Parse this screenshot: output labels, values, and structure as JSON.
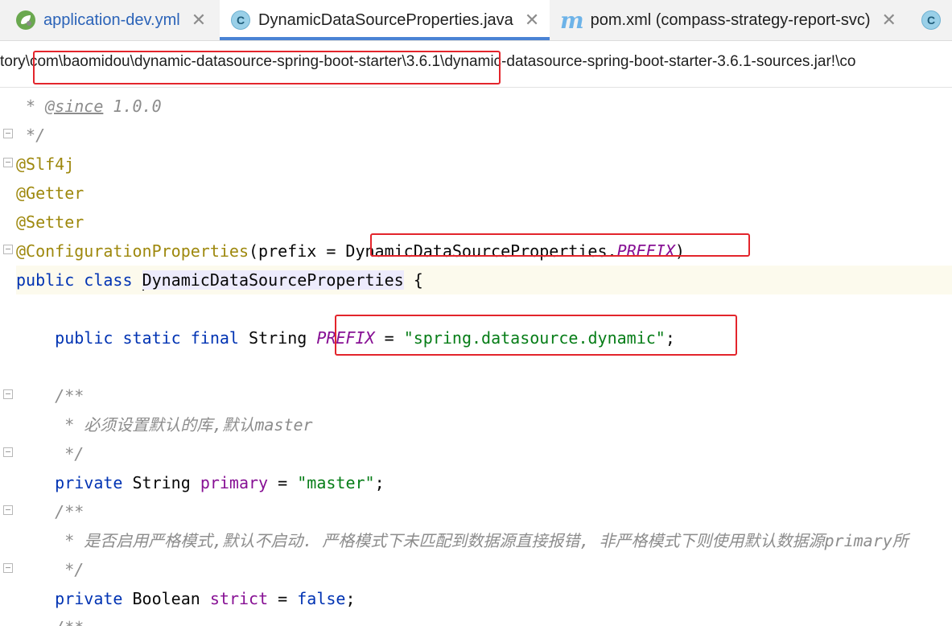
{
  "tabs": [
    {
      "label": "application-dev.yml",
      "icon": "spring-yml-icon",
      "active": false
    },
    {
      "label": "DynamicDataSourceProperties.java",
      "icon": "class-c-icon",
      "active": true
    },
    {
      "label": "pom.xml (compass-strategy-report-svc)",
      "icon": "maven-m-icon",
      "active": false
    },
    {
      "label": "",
      "icon": "class-c-icon",
      "active": false
    }
  ],
  "close_glyph": "✕",
  "breadcrumb": {
    "prefix": "tory\\",
    "highlighted": "com\\baomidou\\dynamic-datasource-spring-boot-starter\\3.6.1\\",
    "rest": "dynamic-datasource-spring-boot-starter-3.6.1-sources.jar!\\co"
  },
  "code": {
    "since_prefix": " * ",
    "since_tag": "@since",
    "since_version": " 1.0.0",
    "comment_end": " */",
    "ann_slf4j": "@Slf4j",
    "ann_getter": "@Getter",
    "ann_setter": "@Setter",
    "ann_config": "@ConfigurationProperties",
    "config_args_open": "(prefix = ",
    "config_class_ref": "DynamicDataSourceProperties",
    "dot": ".",
    "prefix_const": "PREFIX",
    "paren_close": ")",
    "kw_public": "public",
    "kw_class": "class",
    "class_name": "DynamicDataSourceProperties",
    "brace_open": " {",
    "kw_static": "static",
    "kw_final": "final",
    "type_string": "String",
    "equals": " = ",
    "prefix_value": "\"spring.datasource.dynamic\"",
    "semicolon": ";",
    "doc_open": "/**",
    "doc_primary": " * 必须设置默认的库,默认master",
    "doc_close": " */",
    "kw_private": "private",
    "field_primary": "primary",
    "primary_value": "\"master\"",
    "doc_strict": " * 是否启用严格模式,默认不启动. 严格模式下未匹配到数据源直接报错, 非严格模式下则使用默认数据源primary所",
    "type_boolean": "Boolean",
    "field_strict": "strict",
    "strict_value": "false",
    "partial_next": "/**"
  }
}
